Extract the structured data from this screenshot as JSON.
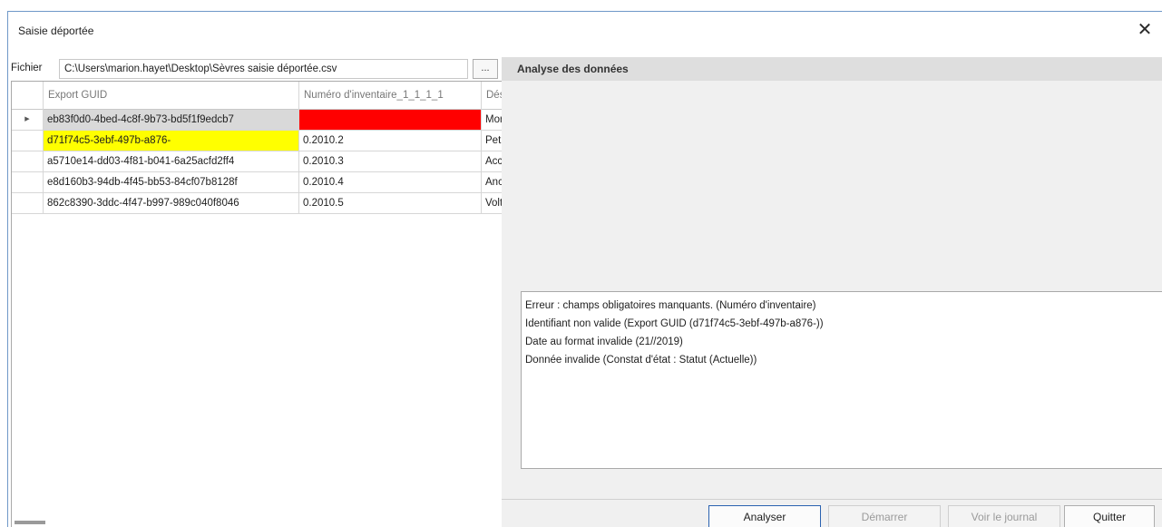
{
  "window": {
    "title": "Saisie déportée",
    "close_icon": "close-icon"
  },
  "file": {
    "label": "Fichier",
    "path": "C:\\Users\\marion.hayet\\Desktop\\Sèvres saisie déportée.csv",
    "browse_label": "..."
  },
  "grid": {
    "columns": [
      "Export GUID",
      "Numéro d'inventaire_1_1_1_1",
      "Dési"
    ],
    "rows": [
      {
        "indicator": "▶",
        "guid": "eb83f0d0-4bed-4c8f-9b73-bd5f1f9edcb7",
        "inventory": "",
        "desig": "Mor",
        "guid_bg": "#d9d9d9",
        "inventory_bg": "#ff0000"
      },
      {
        "indicator": "",
        "guid": "d71f74c5-3ebf-497b-a876-",
        "inventory": "0.2010.2",
        "desig": "Peti",
        "guid_bg": "#ffff00",
        "inventory_bg": "#ffffff"
      },
      {
        "indicator": "",
        "guid": "a5710e14-dd03-4f81-b041-6a25acfd2ff4",
        "inventory": "0.2010.3",
        "desig": "Acc",
        "guid_bg": "#ffffff",
        "inventory_bg": "#ffffff"
      },
      {
        "indicator": "",
        "guid": "e8d160b3-94db-4f45-bb53-84cf07b8128f",
        "inventory": "0.2010.4",
        "desig": "Anc",
        "guid_bg": "#ffffff",
        "inventory_bg": "#ffffff"
      },
      {
        "indicator": "",
        "guid": "862c8390-3ddc-4f47-b997-989c040f8046",
        "inventory": "0.2010.5",
        "desig": "Volt",
        "guid_bg": "#ffffff",
        "inventory_bg": "#ffffff"
      }
    ]
  },
  "analysis": {
    "title": "Analyse des données",
    "messages": [
      "Erreur : champs obligatoires manquants. (Numéro d'inventaire)",
      "Identifiant non valide (Export GUID (d71f74c5-3ebf-497b-a876-))",
      "Date au format invalide (21//2019)",
      "Donnée invalide (Constat d'état : Statut (Actuelle))"
    ]
  },
  "buttons": {
    "analyze": "Analyser",
    "start": "Démarrer",
    "journal": "Voir le journal",
    "quit": "Quitter"
  }
}
